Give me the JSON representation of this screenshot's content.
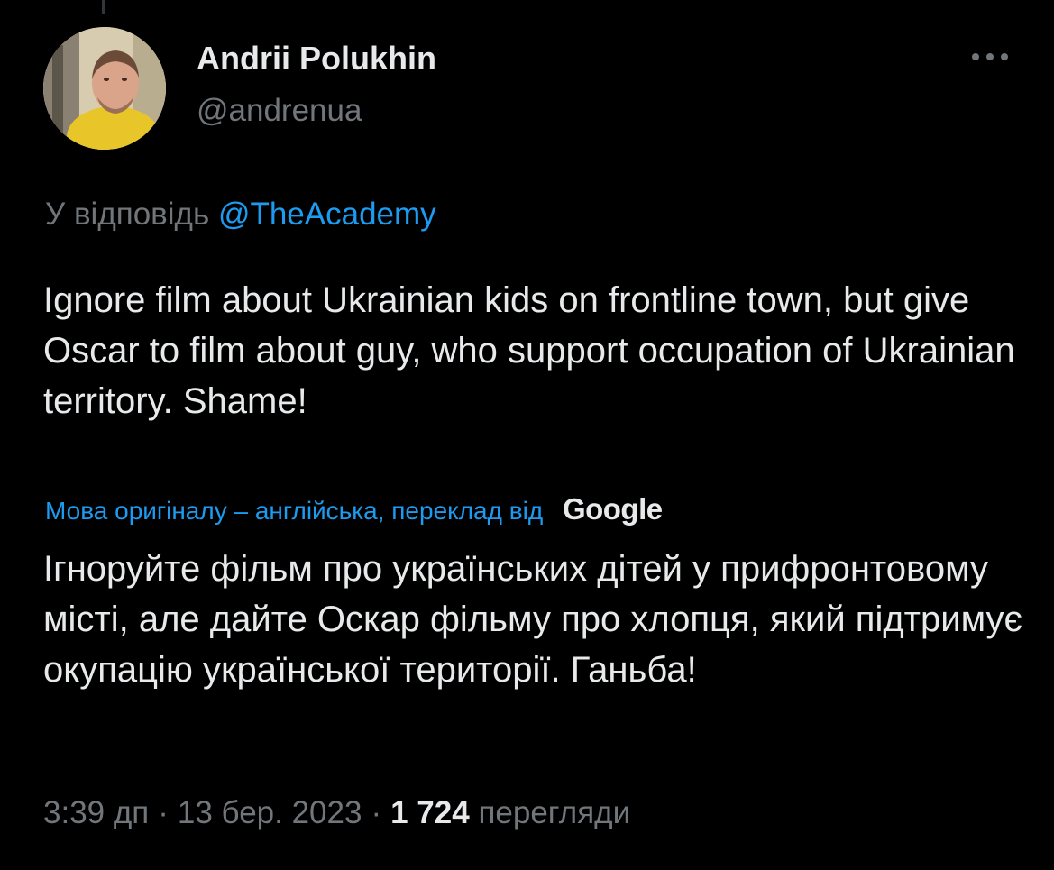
{
  "author": {
    "display_name": "Andrii Polukhin",
    "handle": "@andrenua"
  },
  "reply": {
    "prefix": "У відповідь",
    "mention": "@TheAcademy"
  },
  "tweet": {
    "text": "Ignore film about Ukrainian kids on frontline town, but give Oscar to film about guy, who support occupation of Ukrainian territory. Shame!"
  },
  "translation": {
    "label": "Мова оригіналу – англійська, переклад від",
    "provider": "Google",
    "text": "Ігноруйте фільм про українських дітей у прифронтовому місті, але дайте Оскар фільму про хлопця, який підтримує окупацію української території. Ганьба!"
  },
  "meta": {
    "time": "3:39 дп",
    "separator": "·",
    "date": "13 бер. 2023",
    "views_count": "1 724",
    "views_label": "перегляди"
  },
  "icons": {
    "more": "more-horizontal-icon",
    "avatar": "profile-photo"
  },
  "colors": {
    "background": "#000000",
    "primary_text": "#e7e9ea",
    "secondary_text": "#71767b",
    "accent": "#1d9bf0"
  }
}
